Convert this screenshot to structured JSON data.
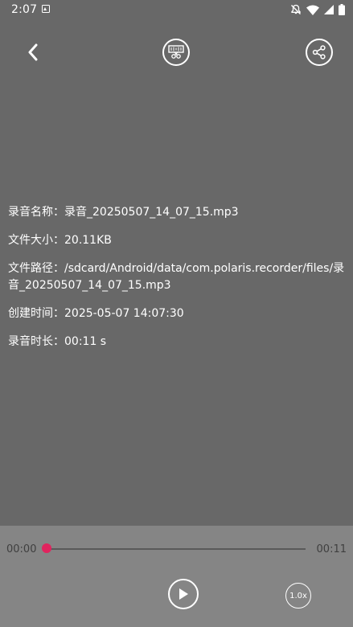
{
  "status_bar": {
    "time": "2:07",
    "icons": [
      "notification-icon",
      "mute-icon",
      "wifi-icon",
      "signal-icon",
      "battery-icon"
    ]
  },
  "toolbar": {
    "back_icon": "chevron-left-icon",
    "cut_icon": "audio-cut-icon",
    "share_icon": "share-icon"
  },
  "info": {
    "name_label": "录音名称：",
    "name_value": "录音_20250507_14_07_15.mp3",
    "size_label": "文件大小：",
    "size_value": "20.11KB",
    "path_label": "文件路径：",
    "path_value": "/sdcard/Android/data/com.polaris.recorder/files/录音_20250507_14_07_15.mp3",
    "created_label": "创建时间：",
    "created_value": "2025-05-07 14:07:30",
    "duration_label": "录音时长：",
    "duration_value": "00:11 s"
  },
  "player": {
    "current_time": "00:00",
    "total_time": "00:11",
    "progress": 0,
    "speed_label": "1.0x",
    "accent_color": "#e0245e"
  }
}
